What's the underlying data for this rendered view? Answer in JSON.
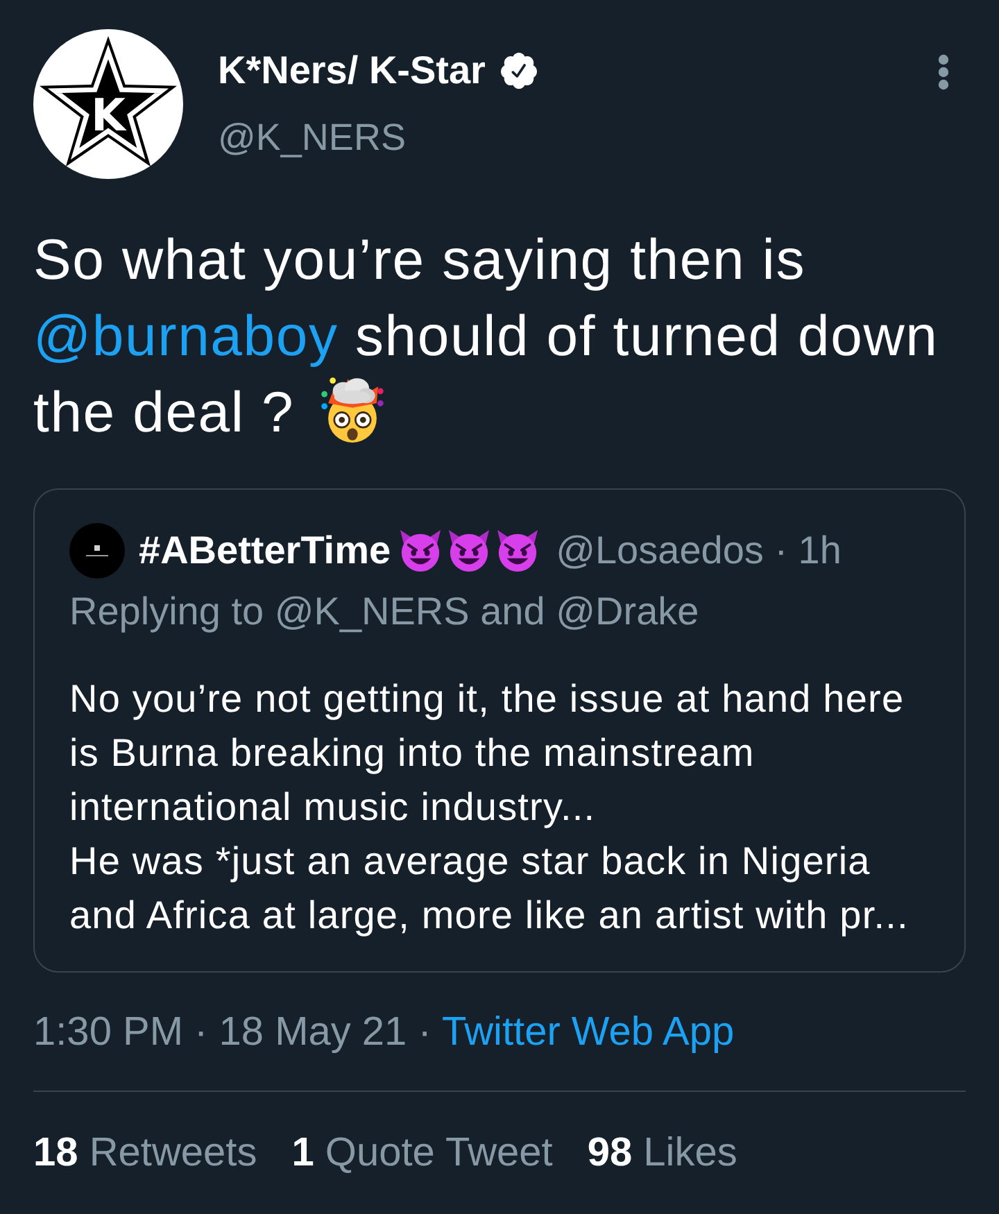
{
  "author": {
    "name": "K*Ners/ K-Star",
    "verified": true,
    "handle": "@K_NERS",
    "avatar_letter": "K"
  },
  "tweet": {
    "segments": [
      {
        "kind": "text",
        "text": "So what you’re saying then is\n"
      },
      {
        "kind": "mention",
        "text": "@burnaboy"
      },
      {
        "kind": "text",
        "text": " should of turned down\nthe deal ?"
      }
    ]
  },
  "quote": {
    "name": "#ABetterTime",
    "meta": "@Losaedos · 1h",
    "replying": "Replying to @K_NERS and @Drake",
    "text": "No you’re not getting it, the issue at hand here\nis Burna breaking into the mainstream\ninternational music industry...\nHe was *just an average star back in Nigeria\nand Africa at large, more like an artist with pr..."
  },
  "footer": {
    "timestamp": "1:30 PM · 18 May 21 ·",
    "source": "Twitter Web App"
  },
  "stats": [
    {
      "count": "18",
      "label": "Retweets"
    },
    {
      "count": "1",
      "label": "Quote Tweet"
    },
    {
      "count": "98",
      "label": "Likes"
    }
  ]
}
